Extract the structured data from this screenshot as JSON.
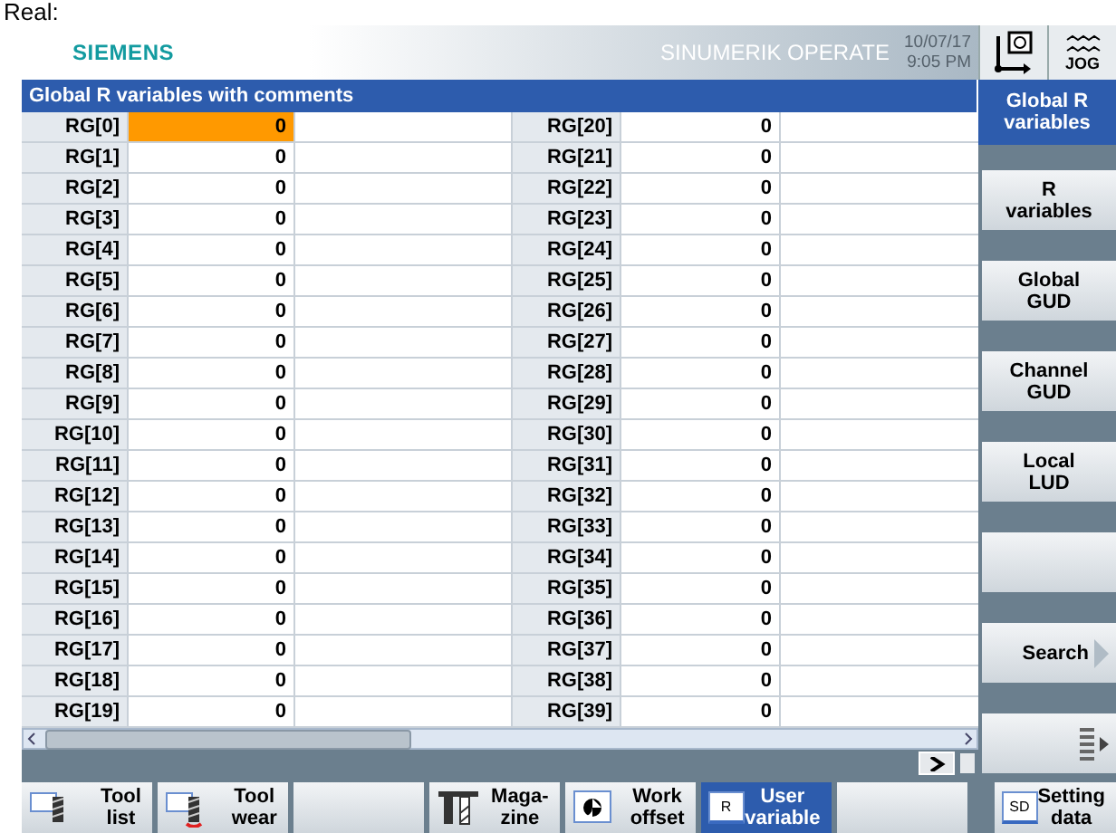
{
  "caption": "Real:",
  "header": {
    "brand": "SIEMENS",
    "product": "SINUMERIK OPERATE",
    "date": "10/07/17",
    "time": "9:05 PM",
    "mode": "JOG"
  },
  "title": "Global R variables with comments",
  "variables": [
    {
      "name": "RG[0]",
      "value": "0",
      "selected": true
    },
    {
      "name": "RG[1]",
      "value": "0",
      "selected": false
    },
    {
      "name": "RG[2]",
      "value": "0",
      "selected": false
    },
    {
      "name": "RG[3]",
      "value": "0",
      "selected": false
    },
    {
      "name": "RG[4]",
      "value": "0",
      "selected": false
    },
    {
      "name": "RG[5]",
      "value": "0",
      "selected": false
    },
    {
      "name": "RG[6]",
      "value": "0",
      "selected": false
    },
    {
      "name": "RG[7]",
      "value": "0",
      "selected": false
    },
    {
      "name": "RG[8]",
      "value": "0",
      "selected": false
    },
    {
      "name": "RG[9]",
      "value": "0",
      "selected": false
    },
    {
      "name": "RG[10]",
      "value": "0",
      "selected": false
    },
    {
      "name": "RG[11]",
      "value": "0",
      "selected": false
    },
    {
      "name": "RG[12]",
      "value": "0",
      "selected": false
    },
    {
      "name": "RG[13]",
      "value": "0",
      "selected": false
    },
    {
      "name": "RG[14]",
      "value": "0",
      "selected": false
    },
    {
      "name": "RG[15]",
      "value": "0",
      "selected": false
    },
    {
      "name": "RG[16]",
      "value": "0",
      "selected": false
    },
    {
      "name": "RG[17]",
      "value": "0",
      "selected": false
    },
    {
      "name": "RG[18]",
      "value": "0",
      "selected": false
    },
    {
      "name": "RG[19]",
      "value": "0",
      "selected": false
    },
    {
      "name": "RG[20]",
      "value": "0",
      "selected": false
    },
    {
      "name": "RG[21]",
      "value": "0",
      "selected": false
    },
    {
      "name": "RG[22]",
      "value": "0",
      "selected": false
    },
    {
      "name": "RG[23]",
      "value": "0",
      "selected": false
    },
    {
      "name": "RG[24]",
      "value": "0",
      "selected": false
    },
    {
      "name": "RG[25]",
      "value": "0",
      "selected": false
    },
    {
      "name": "RG[26]",
      "value": "0",
      "selected": false
    },
    {
      "name": "RG[27]",
      "value": "0",
      "selected": false
    },
    {
      "name": "RG[28]",
      "value": "0",
      "selected": false
    },
    {
      "name": "RG[29]",
      "value": "0",
      "selected": false
    },
    {
      "name": "RG[30]",
      "value": "0",
      "selected": false
    },
    {
      "name": "RG[31]",
      "value": "0",
      "selected": false
    },
    {
      "name": "RG[32]",
      "value": "0",
      "selected": false
    },
    {
      "name": "RG[33]",
      "value": "0",
      "selected": false
    },
    {
      "name": "RG[34]",
      "value": "0",
      "selected": false
    },
    {
      "name": "RG[35]",
      "value": "0",
      "selected": false
    },
    {
      "name": "RG[36]",
      "value": "0",
      "selected": false
    },
    {
      "name": "RG[37]",
      "value": "0",
      "selected": false
    },
    {
      "name": "RG[38]",
      "value": "0",
      "selected": false
    },
    {
      "name": "RG[39]",
      "value": "0",
      "selected": false
    }
  ],
  "side_keys": [
    {
      "kind": "text",
      "label": "Global R\nvariables",
      "selected": true
    },
    {
      "kind": "text",
      "label": "R\nvariables",
      "selected": false
    },
    {
      "kind": "text",
      "label": "Global\nGUD",
      "selected": false
    },
    {
      "kind": "text",
      "label": "Channel\nGUD",
      "selected": false
    },
    {
      "kind": "text",
      "label": "Local\nLUD",
      "selected": false
    },
    {
      "kind": "blank",
      "selected": false
    },
    {
      "kind": "next",
      "label": "Search",
      "selected": false
    },
    {
      "kind": "more",
      "selected": false
    }
  ],
  "bottom_keys": [
    {
      "kind": "tool",
      "label": "Tool\nlist",
      "selected": false
    },
    {
      "kind": "tool-wear",
      "label": "Tool\nwear",
      "selected": false
    },
    {
      "kind": "blank",
      "selected": false
    },
    {
      "kind": "magazine",
      "label": "Maga-\nzine",
      "selected": false
    },
    {
      "kind": "offset",
      "label": "Work\noffset",
      "selected": false
    },
    {
      "kind": "badge",
      "badge": "R",
      "label": "User\nvariable",
      "selected": true
    },
    {
      "kind": "blank",
      "selected": false
    }
  ],
  "setting_key": {
    "badge": "SD",
    "label": "Setting\ndata"
  }
}
